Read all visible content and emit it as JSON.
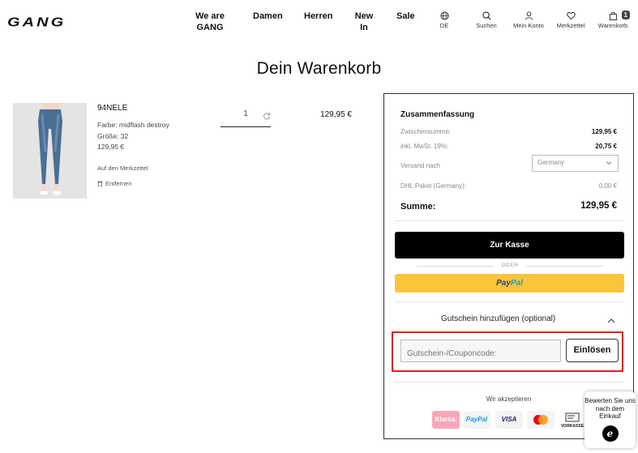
{
  "header": {
    "logo": "GANG",
    "nav": [
      {
        "label": "We are GANG"
      },
      {
        "label": "Damen"
      },
      {
        "label": "Herren"
      },
      {
        "label": "New In"
      },
      {
        "label": "Sale"
      }
    ],
    "icons": [
      {
        "name": "globe-icon",
        "label": "DE"
      },
      {
        "name": "search-icon",
        "label": "Suchen"
      },
      {
        "name": "user-icon",
        "label": "Mein Konto"
      },
      {
        "name": "heart-icon",
        "label": "Merkzettel"
      },
      {
        "name": "bag-icon",
        "label": "Warenkorb",
        "badge": "1"
      }
    ]
  },
  "page_title": "Dein Warenkorb",
  "product": {
    "name": "94NELE",
    "color": "Farbe: midflash destroy",
    "size": "Größe: 32",
    "price": "129,95 €",
    "wishlist_link": "Auf den Merkzettel",
    "remove_link": "Entfernen",
    "quantity": "1",
    "line_total": "129,95 €"
  },
  "summary": {
    "title": "Zusammenfassung",
    "subtotal_label": "Zwischensumme:",
    "subtotal_value": "129,95 €",
    "vat_label": "inkl. MwSt. 19%:",
    "vat_value": "20,75 €",
    "shipping_label": "Versand nach",
    "shipping_country": "Germany",
    "dhl_label": "DHL Paket (Germany):",
    "dhl_value": "0,00 €",
    "total_label": "Summe:",
    "total_value": "129,95 €",
    "checkout_label": "Zur Kasse",
    "or_label": "ODER",
    "paypal_a": "Pay",
    "paypal_b": "Pal",
    "voucher_heading": "Gutschein hinzufügen (optional)",
    "voucher_placeholder": "Gutschein-/Couponcode:",
    "redeem_label": "Einlösen",
    "accept_label": "Wir akzeptieren",
    "payment_methods": [
      "Klarna.",
      "PayPal",
      "VISA",
      "Mastercard",
      "VORKASSE"
    ]
  },
  "rating_widget": {
    "text": "Bewerten Sie uns nach dem Einkauf",
    "logo": "e"
  },
  "colors": {
    "paypal_yellow": "#fcc43a",
    "highlight_red": "#e01e1e",
    "klarna_pink": "#f7a8b8"
  }
}
